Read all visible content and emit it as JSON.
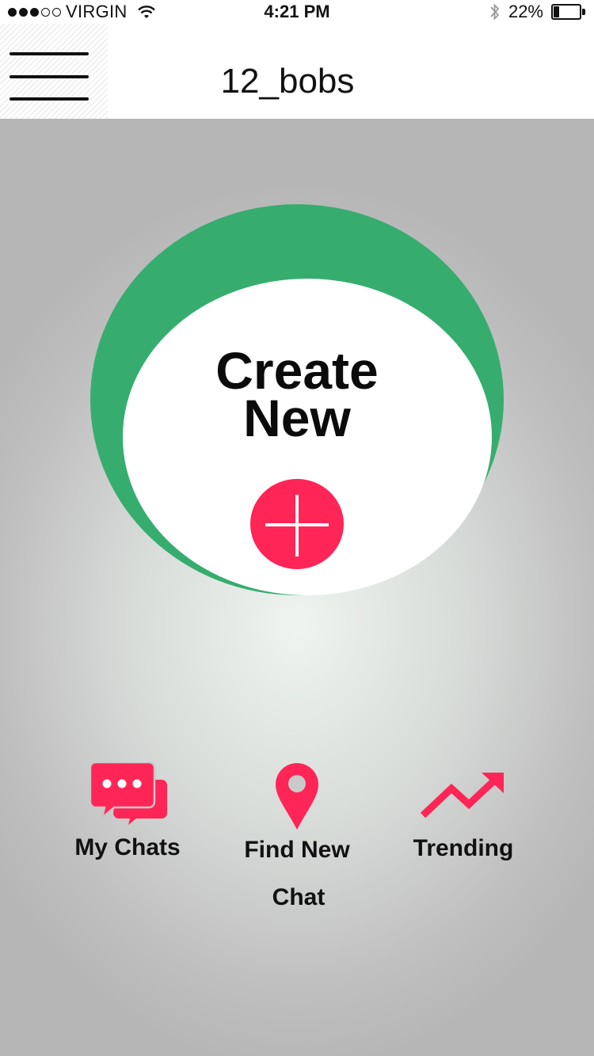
{
  "status_bar": {
    "carrier": "VIRGIN",
    "time": "4:21 PM",
    "battery_percent": "22%",
    "battery_level": 0.22,
    "signal_strength": 3,
    "signal_max": 5,
    "icons": [
      "wifi-icon",
      "bluetooth-icon",
      "battery-icon"
    ]
  },
  "header": {
    "title": "12_bobs",
    "menu_icon": "hamburger-menu-icon"
  },
  "create": {
    "label_line1": "Create",
    "label_line2": "New",
    "plus_icon": "plus-icon"
  },
  "bottom_nav": {
    "items": [
      {
        "label": "My Chats",
        "icon": "chat-bubbles-icon"
      },
      {
        "label_line1": "Find New",
        "label_line2": "Chat",
        "icon": "location-pin-icon"
      },
      {
        "label": "Trending",
        "icon": "trending-up-icon"
      }
    ]
  },
  "colors": {
    "accent": "#ff2556",
    "ring": "#36ad6f",
    "background": "#c4c4c4"
  }
}
